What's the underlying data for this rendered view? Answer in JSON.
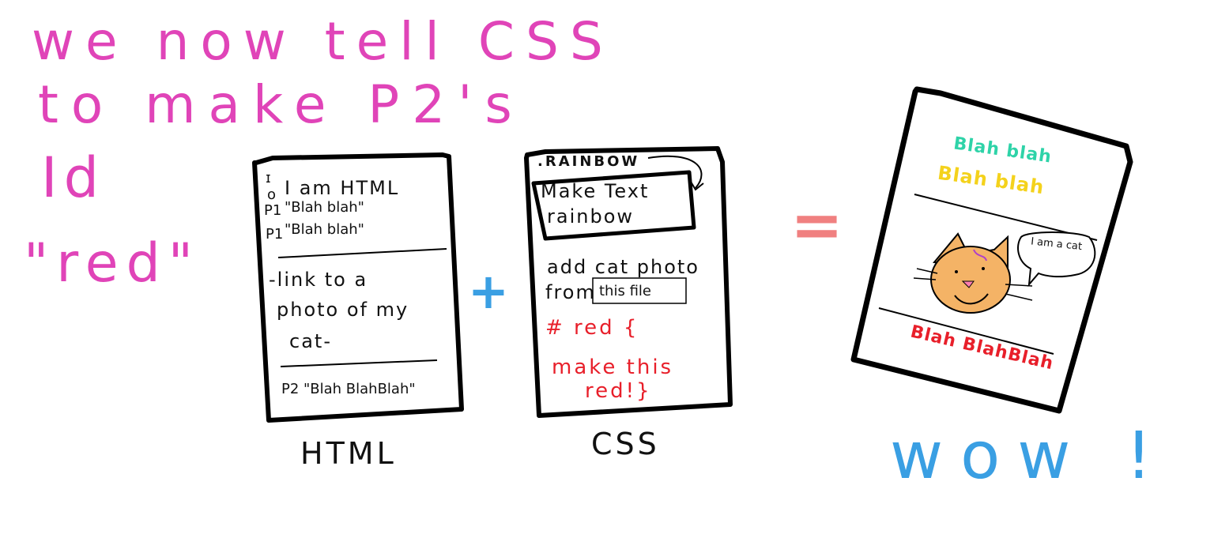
{
  "intro": {
    "line1": "we now tell CSS",
    "line2": "to make P2's",
    "line3": "Id",
    "line4": "\"red\""
  },
  "html_card": {
    "line1": "I am HTML",
    "p1_label_a": "P1",
    "p1_text_a": "\"Blah blah\"",
    "p1_label_b": "P1",
    "p1_text_b": "\"Blah blah\"",
    "link_1": "-link to a",
    "link_2": "photo of my",
    "link_3": "cat-",
    "p2_label": "P2",
    "p2_text": "\"Blah BlahBlah\"",
    "caption": "HTML"
  },
  "css_card": {
    "selector": ".RAINBOW",
    "rule_1": "Make Text",
    "rule_2": "rainbow",
    "add_1": "add cat photo",
    "add_2a": "from",
    "add_2b": "this file",
    "red_1": "# red {",
    "red_2": "make this",
    "red_3": "red!}",
    "caption": "CSS"
  },
  "operators": {
    "plus": "+",
    "equals": "="
  },
  "result_card": {
    "blah_1": "Blah blah",
    "blah_2": "Blah blah",
    "speech": "I am a cat",
    "blah_3": "Blah BlahBlah"
  },
  "exclaim": "wow !",
  "colors": {
    "pink": "#e044b8",
    "blue": "#3a9fe3",
    "red": "#e81f2a",
    "salmon": "#f08080",
    "cat_orange": "#f4b366",
    "teal": "#2ed3a8",
    "yellow": "#f4d21c",
    "magenta": "#e0189a"
  }
}
